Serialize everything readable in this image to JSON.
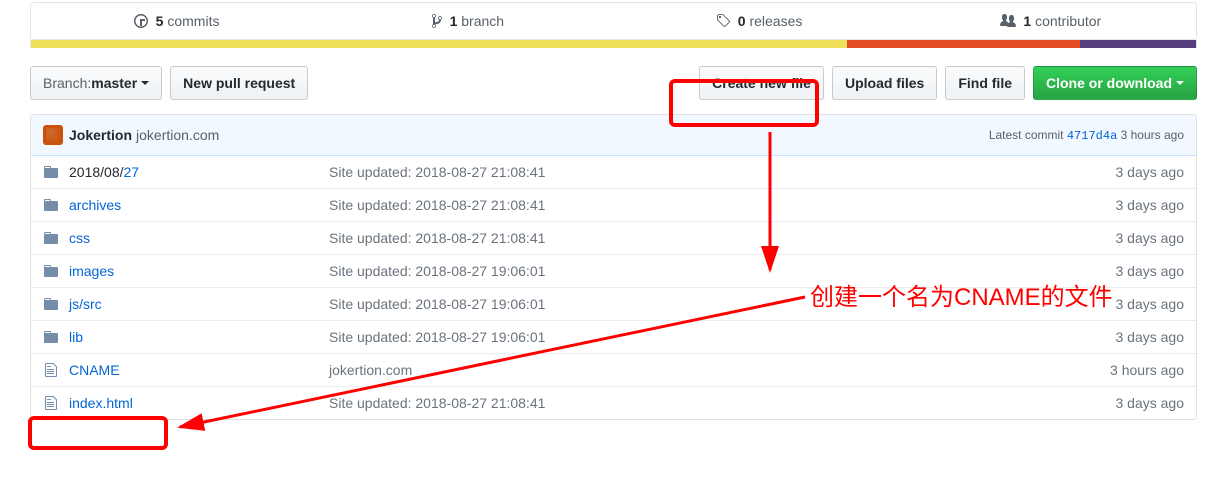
{
  "stats": {
    "commits_count": "5",
    "commits_label": "commits",
    "branches_count": "1",
    "branches_label": "branch",
    "releases_count": "0",
    "releases_label": "releases",
    "contributors_count": "1",
    "contributors_label": "contributor"
  },
  "toolbar": {
    "branch_label": "Branch: ",
    "branch_name": "master",
    "new_pr": "New pull request",
    "create_file": "Create new file",
    "upload": "Upload files",
    "find": "Find file",
    "clone": "Clone or download"
  },
  "commit": {
    "user": "Jokertion",
    "message": "jokertion.com",
    "latest_label": "Latest commit ",
    "sha": "4717d4a",
    "when": " 3 hours ago"
  },
  "files": [
    {
      "type": "dir",
      "name": "2018/08/",
      "name_link": "27",
      "msg": "Site updated: 2018-08-27 21:08:41",
      "age": "3 days ago"
    },
    {
      "type": "dir",
      "name": "",
      "name_link": "archives",
      "msg": "Site updated: 2018-08-27 21:08:41",
      "age": "3 days ago"
    },
    {
      "type": "dir",
      "name": "",
      "name_link": "css",
      "msg": "Site updated: 2018-08-27 21:08:41",
      "age": "3 days ago"
    },
    {
      "type": "dir",
      "name": "",
      "name_link": "images",
      "msg": "Site updated: 2018-08-27 19:06:01",
      "age": "3 days ago"
    },
    {
      "type": "dir",
      "name": "",
      "name_link": "js/src",
      "msg": "Site updated: 2018-08-27 19:06:01",
      "age": "3 days ago"
    },
    {
      "type": "dir",
      "name": "",
      "name_link": "lib",
      "msg": "Site updated: 2018-08-27 19:06:01",
      "age": "3 days ago"
    },
    {
      "type": "file",
      "name": "",
      "name_link": "CNAME",
      "msg": "jokertion.com",
      "age": "3 hours ago"
    },
    {
      "type": "file",
      "name": "",
      "name_link": "index.html",
      "msg": "Site updated: 2018-08-27 21:08:41",
      "age": "3 days ago"
    }
  ],
  "annotation": "创建一个名为CNAME的文件"
}
